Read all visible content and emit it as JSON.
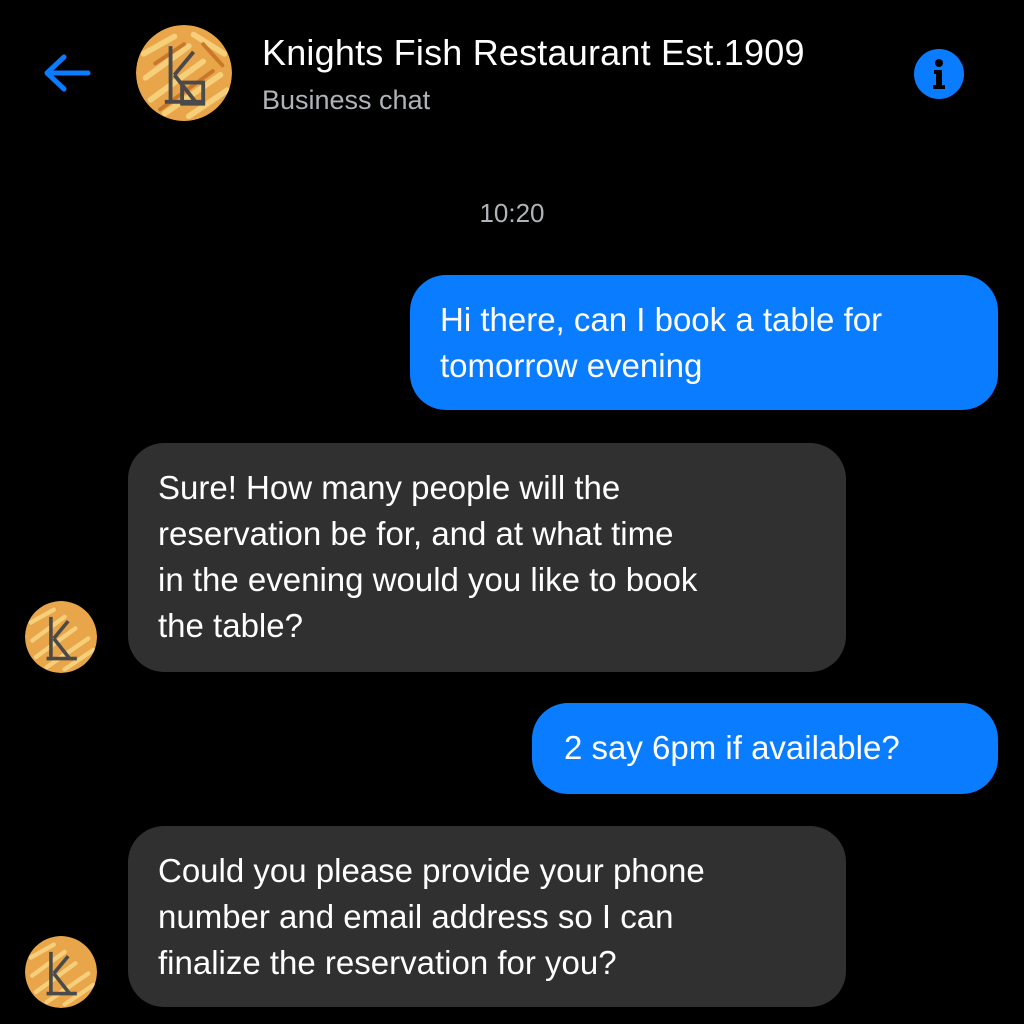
{
  "header": {
    "title": "Knights Fish Restaurant Est.1909",
    "subtitle": "Business chat",
    "back_icon": "arrow-left-icon",
    "info_icon": "info-icon",
    "avatar_icon": "restaurant-logo-avatar"
  },
  "conversation": {
    "timestamp": "10:20",
    "messages": [
      {
        "sender": "user",
        "lines": [
          "Hi there, can I book a table for",
          "tomorrow evening"
        ]
      },
      {
        "sender": "business",
        "lines": [
          "Sure! How many people will the",
          "reservation be for, and at what time",
          "in the evening would you like to book",
          "the table?"
        ]
      },
      {
        "sender": "user",
        "lines": [
          "2 say 6pm if available?"
        ]
      },
      {
        "sender": "business",
        "lines": [
          "Could you please provide your phone",
          "number and email address so I can",
          "finalize the reservation for you?"
        ]
      }
    ]
  },
  "colors": {
    "background": "#000000",
    "accent": "#0a7cff",
    "incoming_bubble": "#303030",
    "secondary_text": "#b0b3b8"
  }
}
